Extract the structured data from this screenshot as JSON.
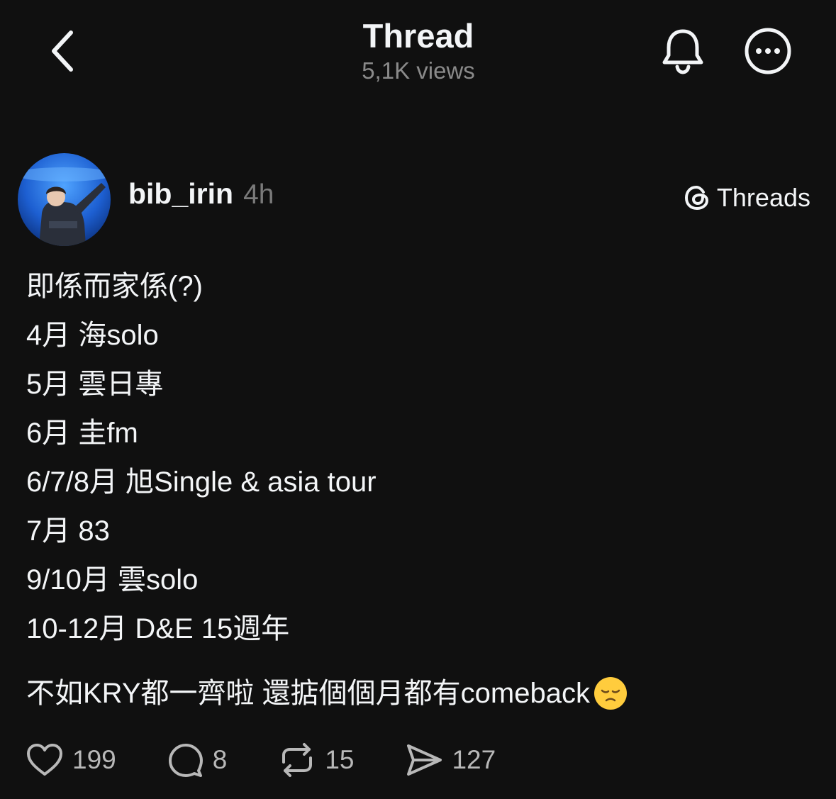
{
  "header": {
    "title": "Thread",
    "views": "5,1K views",
    "icons": [
      "chevron-left-icon",
      "bell-icon",
      "more-icon"
    ]
  },
  "post": {
    "username": "bib_irin",
    "time": "4h",
    "source_label": "Threads",
    "lines": [
      "即係而家係(?)",
      "4月 海solo",
      "5月 雲日專",
      "6月 圭fm",
      "6/7/8月 旭Single & asia tour",
      "7月 83",
      "9/10月 雲solo",
      "10-12月 D&E 15週年"
    ],
    "footer_text": "不如KRY都一齊啦 還掂個個月都有comeback",
    "footer_emoji": "pensive-face-emoji"
  },
  "actions": {
    "likes": "199",
    "replies": "8",
    "reposts": "15",
    "shares": "127"
  },
  "colors": {
    "background": "#101010",
    "text": "#f3f5f7",
    "muted": "#8a8a8a"
  }
}
